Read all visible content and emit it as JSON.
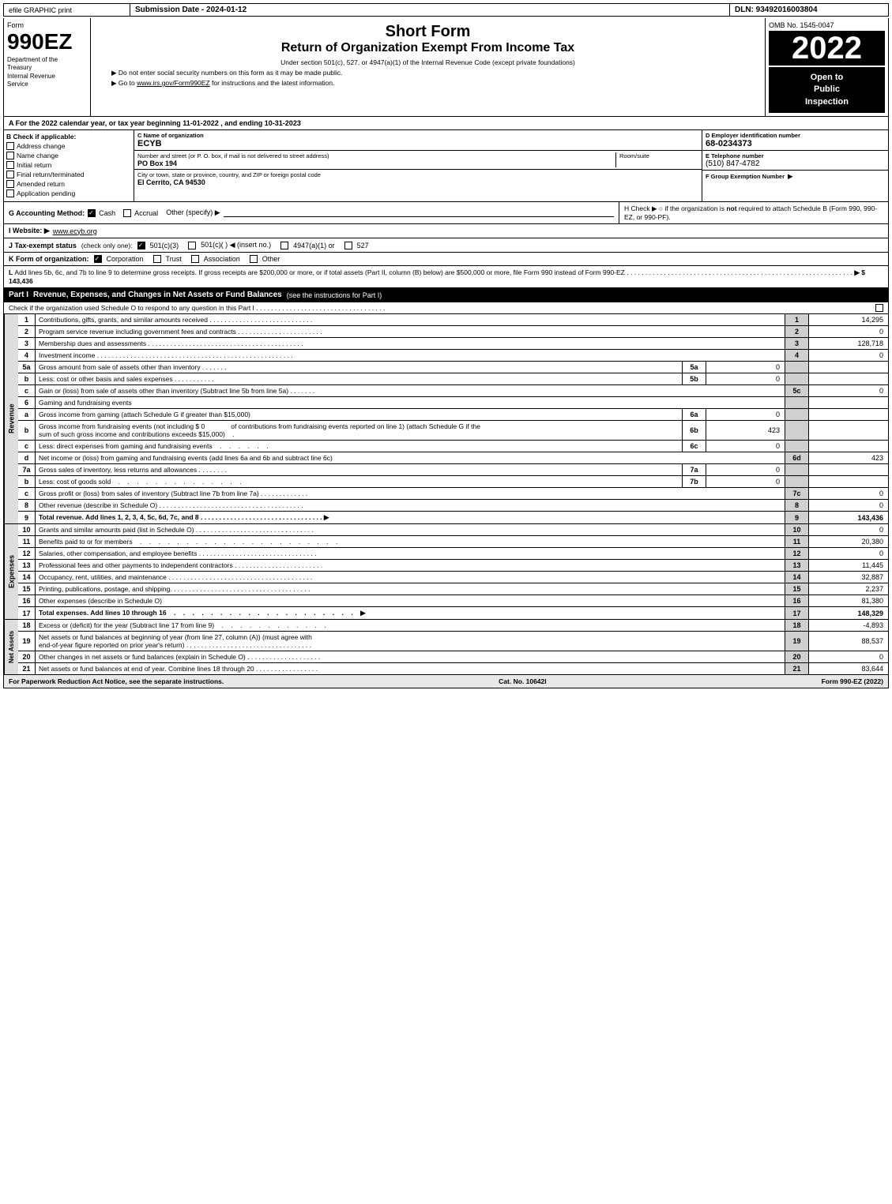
{
  "header_bar": {
    "efile": "efile GRAPHIC print",
    "submission_label": "Submission Date - 2024-01-12",
    "dln": "DLN: 93492016003804"
  },
  "form": {
    "number": "990EZ",
    "dept_line1": "Department of the",
    "dept_line2": "Treasury",
    "dept_line3": "Internal Revenue",
    "dept_line4": "Service"
  },
  "title": {
    "short_form": "Short Form",
    "return_title": "Return of Organization Exempt From Income Tax",
    "subtitle": "Under section 501(c), 527, or 4947(a)(1) of the Internal Revenue Code (except private foundations)",
    "bullet1": "▶ Do not enter social security numbers on this form as it may be made public.",
    "bullet2": "▶ Go to www.irs.gov/Form990EZ for instructions and the latest information.",
    "irs_link": "www.irs.gov/Form990EZ"
  },
  "omb": {
    "label": "OMB No. 1545-0047",
    "year": "2022",
    "open_to_public": "Open to\nPublic\nInspection"
  },
  "section_a": {
    "text": "A  For the 2022 calendar year, or tax year beginning  11-01-2022 , and ending  10-31-2023"
  },
  "section_b": {
    "label": "B  Check if applicable:",
    "checks": [
      {
        "id": "address_change",
        "label": "Address change"
      },
      {
        "id": "name_change",
        "label": "Name change"
      },
      {
        "id": "initial_return",
        "label": "Initial return"
      },
      {
        "id": "final_return",
        "label": "Final return/terminated"
      },
      {
        "id": "amended_return",
        "label": "Amended return"
      },
      {
        "id": "application_pending",
        "label": "Application pending"
      }
    ]
  },
  "org": {
    "name_label": "C Name of organization",
    "name": "ECYB",
    "address_label": "Number and street (or P. O. box, if mail is not delivered to street address)",
    "address": "PO Box 194",
    "room_label": "Room/suite",
    "room": "",
    "city_label": "City or town, state or province, country, and ZIP or foreign postal code",
    "city": "El Cerrito, CA  94530",
    "ein_label": "D Employer identification number",
    "ein": "68-0234373",
    "phone_label": "E Telephone number",
    "phone": "(510) 847-4782",
    "group_label": "F Group Exemption Number",
    "group_arrow": "▶"
  },
  "section_g": {
    "label": "G Accounting Method:",
    "cash_checked": true,
    "cash_label": "Cash",
    "accrual_label": "Accrual",
    "other_label": "Other (specify) ▶"
  },
  "section_h": {
    "text": "H  Check ▶  ○ if the organization is not required to attach Schedule B (Form 990, 990-EZ, or 990-PF)."
  },
  "section_i": {
    "label": "I Website: ▶",
    "url": "www.ecyb.org"
  },
  "section_j": {
    "label": "J Tax-exempt status",
    "note": "(check only one):",
    "options": [
      "☑ 501(c)(3)",
      "○ 501(c)(  ) ◀ (insert no.)",
      "○ 4947(a)(1) or",
      "○ 527"
    ]
  },
  "section_k": {
    "label": "K Form of organization:",
    "options": [
      "☑ Corporation",
      "○ Trust",
      "○ Association",
      "○ Other"
    ]
  },
  "section_l": {
    "text": "L Add lines 5b, 6c, and 7b to line 9 to determine gross receipts. If gross receipts are $200,000 or more, or if total assets (Part II, column (B) below) are $500,000 or more, file Form 990 instead of Form 990-EZ",
    "dots": ". . . . . . . . . . . . . . . . . . . . . . . . . . . . . . . . . . . . . . . . . . . . . . . . . . . . . . . . . . . . .",
    "arrow": "▶ $",
    "value": "143,436"
  },
  "part1": {
    "label": "Part I",
    "title": "Revenue, Expenses, and Changes in Net Assets or Fund Balances",
    "subtitle": "(see the instructions for Part I)",
    "check_note": "Check if the organization used Schedule O to respond to any question in this Part I",
    "rows": [
      {
        "num": "1",
        "desc": "Contributions, gifts, grants, and similar amounts received",
        "line": "1",
        "value": "14,295"
      },
      {
        "num": "2",
        "desc": "Program service revenue including government fees and contracts",
        "line": "2",
        "value": "0"
      },
      {
        "num": "3",
        "desc": "Membership dues and assessments",
        "line": "3",
        "value": "128,718"
      },
      {
        "num": "4",
        "desc": "Investment income",
        "line": "4",
        "value": "0"
      },
      {
        "num": "5a",
        "desc": "Gross amount from sale of assets other than inventory",
        "sub": "5a",
        "subval": "0"
      },
      {
        "num": "b",
        "desc": "Less: cost or other basis and sales expenses",
        "sub": "5b",
        "subval": "0"
      },
      {
        "num": "c",
        "desc": "Gain or (loss) from sale of assets other than inventory (Subtract line 5b from line 5a)",
        "line": "5c",
        "value": "0"
      },
      {
        "num": "6",
        "desc": "Gaming and fundraising events"
      },
      {
        "num": "a",
        "desc": "Gross income from gaming (attach Schedule G if greater than $15,000)",
        "sub": "6a",
        "subval": "0"
      },
      {
        "num": "b",
        "desc": "Gross income from fundraising events (not including $ 0 of contributions from fundraising events reported on line 1) (attach Schedule G if the sum of such gross income and contributions exceeds $15,000)",
        "sub": "6b",
        "subval": "423"
      },
      {
        "num": "c",
        "desc": "Less: direct expenses from gaming and fundraising events",
        "sub": "6c",
        "subval": "0"
      },
      {
        "num": "d",
        "desc": "Net income or (loss) from gaming and fundraising events (add lines 6a and 6b and subtract line 6c)",
        "line": "6d",
        "value": "423"
      },
      {
        "num": "7a",
        "desc": "Gross sales of inventory, less returns and allowances",
        "sub": "7a",
        "subval": "0"
      },
      {
        "num": "b",
        "desc": "Less: cost of goods sold",
        "sub": "7b",
        "subval": "0"
      },
      {
        "num": "c",
        "desc": "Gross profit or (loss) from sales of inventory (Subtract line 7b from line 7a)",
        "line": "7c",
        "value": "0"
      },
      {
        "num": "8",
        "desc": "Other revenue (describe in Schedule O)",
        "line": "8",
        "value": "0"
      },
      {
        "num": "9",
        "desc": "Total revenue. Add lines 1, 2, 3, 4, 5c, 6d, 7c, and 8",
        "arrow": "▶",
        "line": "9",
        "value": "143,436",
        "bold": true
      }
    ]
  },
  "expenses": {
    "rows": [
      {
        "num": "10",
        "desc": "Grants and similar amounts paid (list in Schedule O)",
        "dots": true,
        "line": "10",
        "value": "0"
      },
      {
        "num": "11",
        "desc": "Benefits paid to or for members",
        "dots": true,
        "line": "11",
        "value": "20,380"
      },
      {
        "num": "12",
        "desc": "Salaries, other compensation, and employee benefits",
        "dots": true,
        "line": "12",
        "value": "0"
      },
      {
        "num": "13",
        "desc": "Professional fees and other payments to independent contractors",
        "dots": true,
        "line": "13",
        "value": "11,445"
      },
      {
        "num": "14",
        "desc": "Occupancy, rent, utilities, and maintenance",
        "dots": true,
        "line": "14",
        "value": "32,887"
      },
      {
        "num": "15",
        "desc": "Printing, publications, postage, and shipping.",
        "dots": true,
        "line": "15",
        "value": "2,237"
      },
      {
        "num": "16",
        "desc": "Other expenses (describe in Schedule O)",
        "line": "16",
        "value": "81,380"
      },
      {
        "num": "17",
        "desc": "Total expenses. Add lines 10 through 16",
        "dots": true,
        "arrow": "▶",
        "line": "17",
        "value": "148,329",
        "bold": true
      }
    ]
  },
  "net_assets": {
    "rows": [
      {
        "num": "18",
        "desc": "Excess or (deficit) for the year (Subtract line 17 from line 9)",
        "dots": true,
        "line": "18",
        "value": "-4,893"
      },
      {
        "num": "19",
        "desc": "Net assets or fund balances at beginning of year (from line 27, column (A)) (must agree with end-of-year figure reported on prior year's return)",
        "dots": true,
        "line": "19",
        "value": "88,537"
      },
      {
        "num": "20",
        "desc": "Other changes in net assets or fund balances (explain in Schedule O)",
        "dots": true,
        "line": "20",
        "value": "0"
      },
      {
        "num": "21",
        "desc": "Net assets or fund balances at end of year. Combine lines 18 through 20",
        "dots": true,
        "line": "21",
        "value": "83,644"
      }
    ]
  },
  "footer": {
    "paperwork": "For Paperwork Reduction Act Notice, see the separate instructions.",
    "cat_no": "Cat. No. 10642I",
    "form_label": "Form 990-EZ (2022)"
  }
}
